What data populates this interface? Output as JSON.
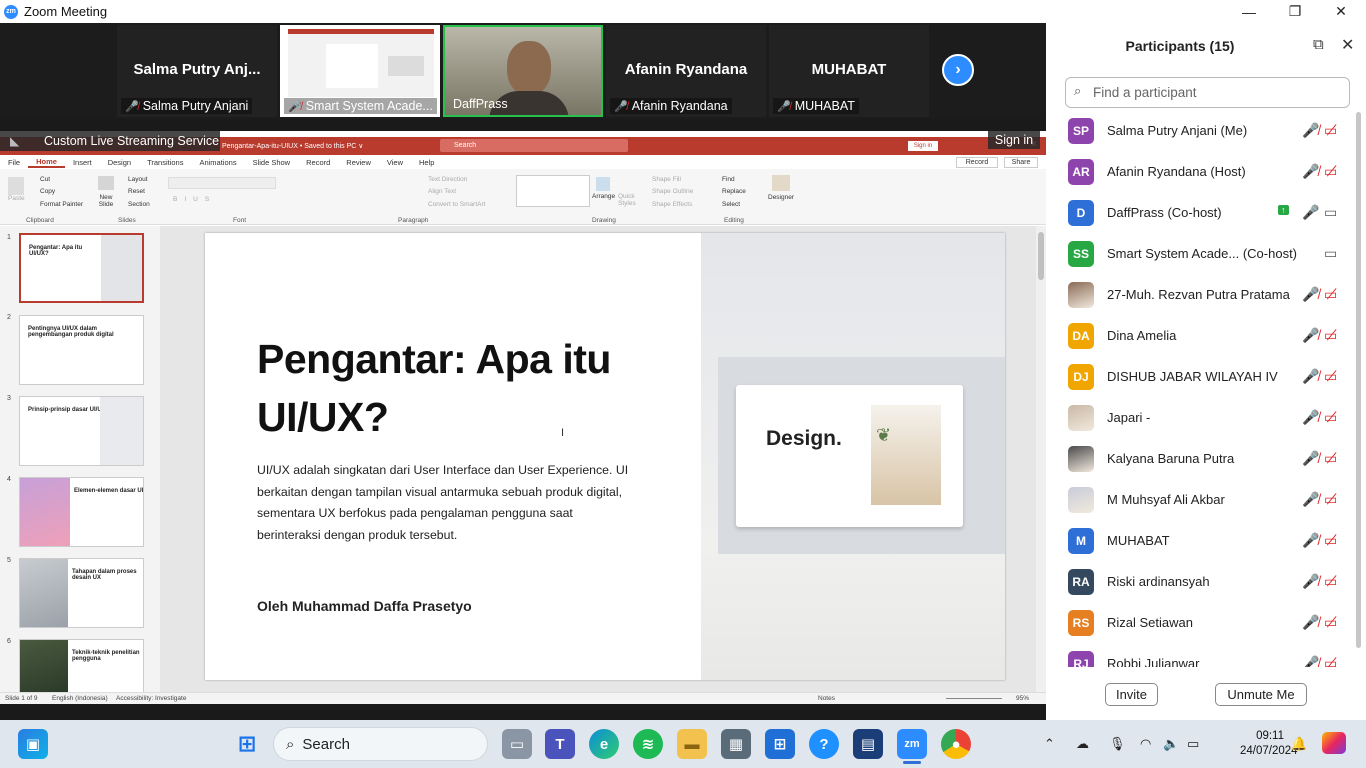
{
  "window": {
    "title": "Zoom Meeting",
    "logo": "zm",
    "minimize": "—",
    "maximize": "❐",
    "close": "✕"
  },
  "video_strip": {
    "tiles": [
      {
        "big_name": "Salma Putry Anj...",
        "name": "Salma Putry Anjani",
        "muted": true
      },
      {
        "big_name": "",
        "name": "Smart System Acade...",
        "muted": true
      },
      {
        "big_name": "",
        "name": "DaffPrass",
        "muted": false
      },
      {
        "big_name": "Afanin Ryandana",
        "name": "Afanin Ryandana",
        "muted": true
      },
      {
        "big_name": "MUHABAT",
        "name": "MUHABAT",
        "muted": true
      }
    ]
  },
  "share": {
    "banner": "Custom Live Streaming Service",
    "sign_in": "Sign in",
    "powerpoint": {
      "doc_title": "Pengantar-Apa-itu-UIUX • Saved to this PC ∨",
      "search": "Search",
      "sign_in": "Sign in",
      "tabs": [
        "File",
        "Home",
        "Insert",
        "Design",
        "Transitions",
        "Animations",
        "Slide Show",
        "Record",
        "Review",
        "View",
        "Help"
      ],
      "record_btn": "Record",
      "share_btn": "Share",
      "ribbon": {
        "clipboard": {
          "label": "Clipboard",
          "paste": "Paste",
          "cut": "Cut",
          "copy": "Copy",
          "format_painter": "Format Painter"
        },
        "slides": {
          "label": "Slides",
          "new_slide": "New Slide",
          "layout": "Layout",
          "reset": "Reset",
          "section": "Section"
        },
        "font": {
          "label": "Font"
        },
        "paragraph": {
          "label": "Paragraph",
          "text_direction": "Text Direction",
          "align_text": "Align Text",
          "convert": "Convert to SmartArt"
        },
        "drawing": {
          "label": "Drawing",
          "arrange": "Arrange",
          "quick_styles": "Quick Styles",
          "shape_fill": "Shape Fill",
          "shape_outline": "Shape Outline",
          "shape_effects": "Shape Effects"
        },
        "editing": {
          "label": "Editing",
          "find": "Find",
          "replace": "Replace",
          "select": "Select"
        },
        "designer": "Designer"
      },
      "thumbnails": [
        {
          "num": "1",
          "title": "Pengantar: Apa itu UI/UX?"
        },
        {
          "num": "2",
          "title": "Pentingnya UI/UX dalam pengembangan produk digital"
        },
        {
          "num": "3",
          "title": "Prinsip-prinsip dasar UI/UX"
        },
        {
          "num": "4",
          "title": "Elemen-elemen dasar UI"
        },
        {
          "num": "5",
          "title": "Tahapan dalam proses desain UX"
        },
        {
          "num": "6",
          "title": "Teknik-teknik penelitian pengguna"
        }
      ],
      "slide": {
        "title": "Pengantar: Apa itu UI/UX?",
        "body": "UI/UX adalah singkatan dari User Interface dan User Experience. UI berkaitan dengan tampilan visual antarmuka sebuah produk digital, sementara UX berfokus pada pengalaman pengguna saat berinteraksi dengan produk tersebut.",
        "author": "Oleh Muhammad Daffa Prasetyo",
        "mockup_heading": "Design."
      },
      "status": {
        "slide_of": "Slide 1 of 9",
        "language": "English (Indonesia)",
        "accessibility": "Accessibility: Investigate",
        "notes": "Notes",
        "zoom": "95%"
      }
    }
  },
  "participants": {
    "title": "Participants (15)",
    "search_placeholder": "Find a participant",
    "list": [
      {
        "initials": "SP",
        "color": "#8e44ad",
        "name": "Salma Putry Anjani (Me)",
        "mic": "off",
        "cam": "off"
      },
      {
        "initials": "AR",
        "color": "#8e44ad",
        "name": "Afanin Ryandana (Host)",
        "mic": "off",
        "cam": "off"
      },
      {
        "initials": "D",
        "color": "#2d6fd6",
        "name": "DaffPrass (Co-host)",
        "mic": "on",
        "cam": "on",
        "sharing": true
      },
      {
        "initials": "SS",
        "color": "#27a845",
        "name": "Smart System Acade...  (Co-host)",
        "mic": "none",
        "cam": "on"
      },
      {
        "initials": "",
        "color": "#8a6a55",
        "name": "27-Muh. Rezvan Putra Pratama",
        "mic": "off",
        "cam": "off",
        "photo": true
      },
      {
        "initials": "DA",
        "color": "#f0a500",
        "name": "Dina Amelia",
        "mic": "off",
        "cam": "off"
      },
      {
        "initials": "DJ",
        "color": "#f0a500",
        "name": "DISHUB JABAR WILAYAH IV",
        "mic": "off",
        "cam": "off"
      },
      {
        "initials": "",
        "color": "#c9b8a6",
        "name": "Japari -",
        "mic": "off",
        "cam": "off",
        "photo": true
      },
      {
        "initials": "",
        "color": "#4a4a4a",
        "name": "Kalyana Baruna Putra",
        "mic": "off",
        "cam": "off",
        "photo": true
      },
      {
        "initials": "",
        "color": "#c8ccd8",
        "name": "M Muhsyaf Ali Akbar",
        "mic": "off",
        "cam": "off",
        "photo": true
      },
      {
        "initials": "M",
        "color": "#2d6fd6",
        "name": "MUHABAT",
        "mic": "off",
        "cam": "off"
      },
      {
        "initials": "RA",
        "color": "#34495e",
        "name": "Riski ardinansyah",
        "mic": "off",
        "cam": "off"
      },
      {
        "initials": "RS",
        "color": "#e67e22",
        "name": "Rizal Setiawan",
        "mic": "off",
        "cam": "off"
      },
      {
        "initials": "RJ",
        "color": "#8e44ad",
        "name": "Robbi Julianwar",
        "mic": "off",
        "cam": "off"
      }
    ],
    "invite": "Invite",
    "unmute_me": "Unmute Me"
  },
  "taskbar": {
    "search": "Search",
    "time": "09:11",
    "date": "24/07/2024",
    "apps": [
      "start-icon",
      "widgets-icon",
      "task-view-icon",
      "teams-icon",
      "edge-icon",
      "spotify-icon",
      "explorer-icon",
      "calculator-icon",
      "store-icon",
      "help-icon",
      "news-icon",
      "zoom-icon",
      "chrome-icon"
    ]
  }
}
